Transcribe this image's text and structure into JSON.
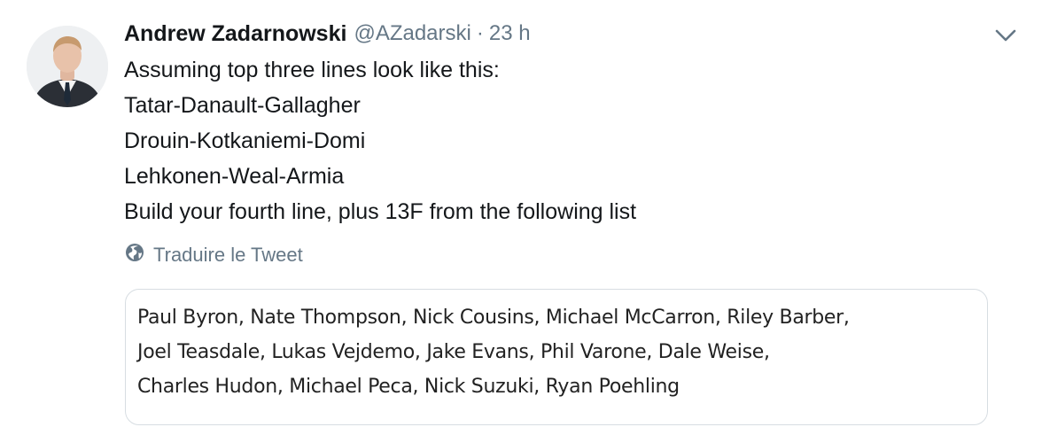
{
  "tweet": {
    "author_name": "Andrew Zadarnowski",
    "handle": "@AZadarski",
    "separator": "·",
    "time": "23 h",
    "lines": [
      "Assuming top three lines look like this:",
      "Tatar-Danault-Gallagher",
      "Drouin-Kotkaniemi-Domi",
      "Lehkonen-Weal-Armia",
      "Build your fourth line, plus 13F from the following list"
    ],
    "translate_label": "Traduire le Tweet",
    "image_text_lines": [
      "Paul Byron, Nate Thompson, Nick Cousins, Michael McCarron, Riley Barber,",
      "Joel Teasdale, Lukas Vejdemo, Jake Evans, Phil Varone, Dale Weise,",
      "Charles Hudon, Michael Peca, Nick Suzuki, Ryan Poehling"
    ],
    "icons": {
      "menu": "chevron-down-icon",
      "translate": "globe-icon"
    },
    "colors": {
      "text": "#14171a",
      "secondary": "#657786",
      "border": "#d7dde2"
    }
  }
}
